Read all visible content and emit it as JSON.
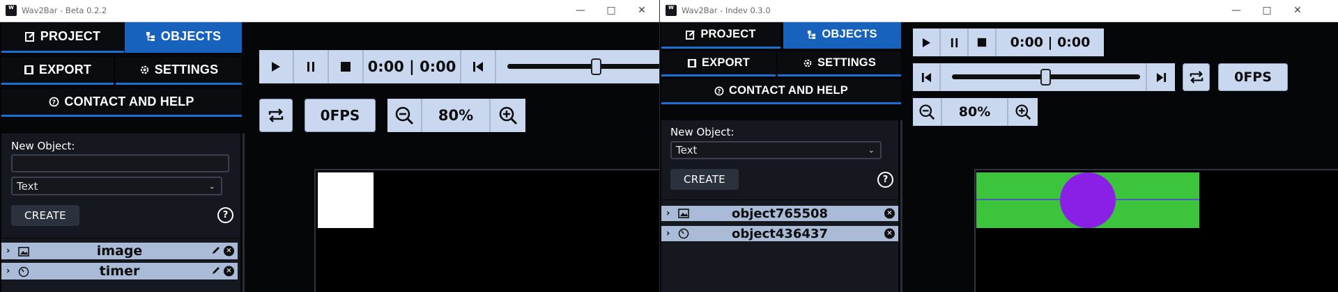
{
  "window_left": {
    "title": "Wav2Bar - Beta 0.2.2",
    "logo_text": "W",
    "tabs": {
      "project": "PROJECT",
      "objects": "OBJECTS",
      "export": "EXPORT",
      "settings": "SETTINGS",
      "contact": "CONTACT AND HELP"
    },
    "active_tab": "objects",
    "new_object_label": "New Object:",
    "new_object_name_value": "",
    "type_select_value": "Text",
    "create_label": "CREATE",
    "objects": [
      {
        "name": "image",
        "icon": "image-icon"
      },
      {
        "name": "timer",
        "icon": "clock-icon"
      }
    ],
    "time_display": "0:00 | 0:00",
    "fps_label": "0FPS",
    "zoom_label": "80%",
    "slider_position": 0.67
  },
  "window_right": {
    "title": "Wav2Bar - Indev 0.3.0",
    "logo_text": "W",
    "tabs": {
      "project": "PROJECT",
      "objects": "OBJECTS",
      "export": "EXPORT",
      "settings": "SETTINGS",
      "contact": "CONTACT AND HELP"
    },
    "active_tab": "objects",
    "new_object_label": "New Object:",
    "type_select_value": "Text",
    "create_label": "CREATE",
    "objects": [
      {
        "name": "object765508",
        "icon": "image-icon"
      },
      {
        "name": "object436437",
        "icon": "clock-icon"
      }
    ],
    "time_display": "0:00 | 0:00",
    "fps_label": "0FPS",
    "zoom_label": "80%",
    "slider_position": 0.5
  },
  "colors": {
    "active_tab": "#1762bd",
    "tab_underline": "#1a6fd0",
    "object_row": "#a9bbd6",
    "control_pill": "#c9d7ef",
    "canvas_green": "#3cc43c",
    "canvas_purple": "#8a1fe6",
    "canvas_white_square": "#ffffff"
  }
}
